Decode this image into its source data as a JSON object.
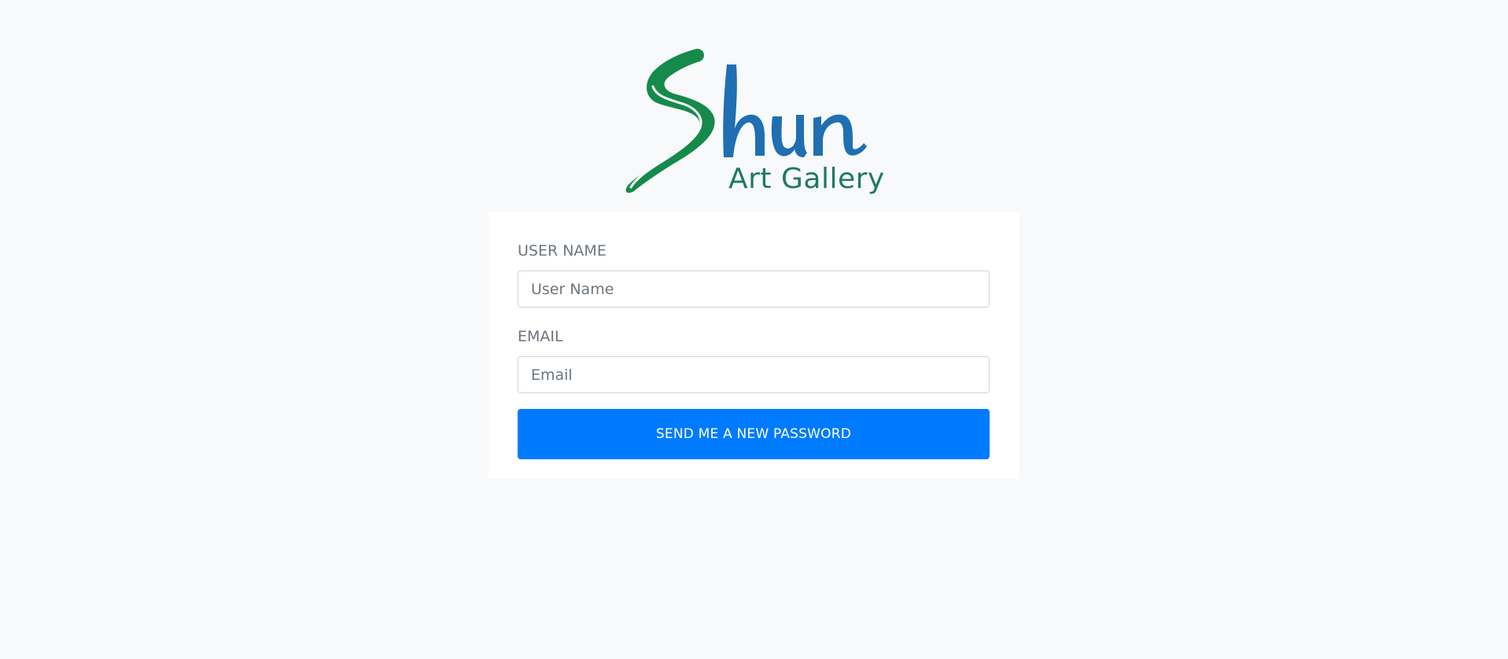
{
  "brand": {
    "logo_name": "Shun",
    "logo_subtitle": "Art Gallery",
    "colors": {
      "green": "#158a4b",
      "blue": "#1f6fb2",
      "subtitle": "#1e7a63"
    }
  },
  "form": {
    "username": {
      "label": "USER NAME",
      "placeholder": "User Name",
      "value": ""
    },
    "email": {
      "label": "EMAIL",
      "placeholder": "Email",
      "value": ""
    },
    "submit_label": "SEND ME A NEW PASSWORD"
  },
  "colors": {
    "page_background": "#f8f9fa",
    "card_background": "#ffffff",
    "button": "#007bff",
    "label": "#6c757d"
  }
}
